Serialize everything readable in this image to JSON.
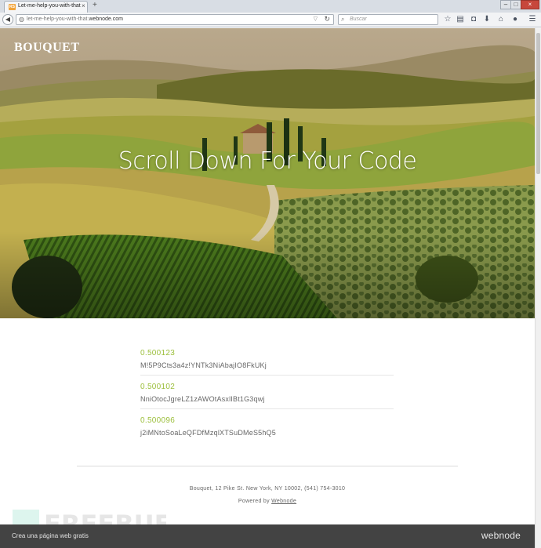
{
  "browser": {
    "tab_title": "Let-me-help-you-with-that",
    "tab_favicon": "RS",
    "tab_close": "×",
    "new_tab": "+",
    "url_prefix": "let-me-help-you-with-that.",
    "url_domain": "webnode.com",
    "search_placeholder": "Buscar",
    "window_controls": [
      "–",
      "□",
      "×"
    ]
  },
  "hero": {
    "brand": "BOUQUET",
    "title": "Scroll Down For Your Code"
  },
  "codes": [
    {
      "score": "0.500123",
      "value": "M!5P9Cts3a4z!YNTk3NiAbajIO8FkUKj"
    },
    {
      "score": "0.500102",
      "value": "NniOtocJgreLZ1zAWOtAsxlIBt1G3qwj"
    },
    {
      "score": "0.500096",
      "value": "j2iMNtoSoaLeQFDfMzqlXTSuDMeS5hQ5"
    }
  ],
  "footer": {
    "address": "Bouquet, 12 Pike St. New York, NY 10002, (541) 754-3010",
    "powered_prefix": "Powered by ",
    "powered_link": "Webnode"
  },
  "bottom_bar": {
    "cta": "Crea una página web gratis",
    "logo": "webnode"
  },
  "watermark": "FREEBUF",
  "colors": {
    "accent_green": "#9cbf3c",
    "bottom_bar": "#434343"
  }
}
